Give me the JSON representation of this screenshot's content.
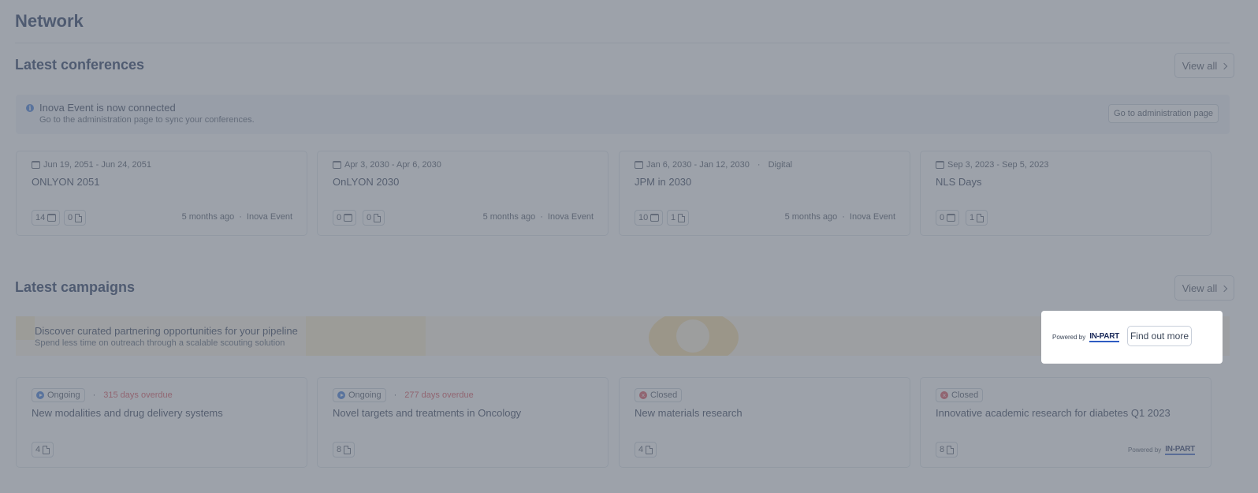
{
  "page": {
    "title": "Network"
  },
  "conferences": {
    "title": "Latest conferences",
    "view_all": "View all",
    "banner": {
      "title": "Inova Event is now connected",
      "subtitle": "Go to the administration page to sync your conferences.",
      "button": "Go to administration page"
    },
    "cards": [
      {
        "date": "Jun 19, 2051 - Jun 24, 2051",
        "tag": "",
        "name": "ONLYON 2051",
        "events": "14",
        "docs": "0",
        "updated": "5 months ago",
        "source": "Inova Event"
      },
      {
        "date": "Apr 3, 2030 - Apr 6, 2030",
        "tag": "",
        "name": "OnLYON 2030",
        "events": "0",
        "docs": "0",
        "updated": "5 months ago",
        "source": "Inova Event"
      },
      {
        "date": "Jan 6, 2030 - Jan 12, 2030",
        "tag": "Digital",
        "name": "JPM in 2030",
        "events": "10",
        "docs": "1",
        "updated": "5 months ago",
        "source": "Inova Event"
      },
      {
        "date": "Sep 3, 2023 - Sep 5, 2023",
        "tag": "",
        "name": "NLS Days",
        "events": "0",
        "docs": "1",
        "updated": "",
        "source": ""
      }
    ]
  },
  "campaigns": {
    "title": "Latest campaigns",
    "view_all": "View all",
    "promo": {
      "title": "Discover curated partnering opportunities for your pipeline",
      "subtitle": "Spend less time on outreach through a scalable scouting solution",
      "powered_by": "Powered by",
      "brand": "IN-PART",
      "button": "Find out more"
    },
    "cards": [
      {
        "status": "Ongoing",
        "status_type": "ongoing",
        "overdue": "315 days overdue",
        "name": "New modalities and drug delivery systems",
        "docs": "4"
      },
      {
        "status": "Ongoing",
        "status_type": "ongoing",
        "overdue": "277 days overdue",
        "name": "Novel targets and treatments in Oncology",
        "docs": "8"
      },
      {
        "status": "Closed",
        "status_type": "closed",
        "overdue": "",
        "name": "New materials research",
        "docs": "4"
      },
      {
        "status": "Closed",
        "status_type": "closed",
        "overdue": "",
        "name": "Innovative academic research for diabetes Q1 2023",
        "docs": "8",
        "powered_by": "Powered by",
        "brand": "IN-PART"
      }
    ]
  },
  "colors": {
    "overlay": "#6e7682",
    "accent_blue": "#2c6fd6",
    "danger_red": "#d9434f",
    "title_navy": "#0f2350"
  }
}
